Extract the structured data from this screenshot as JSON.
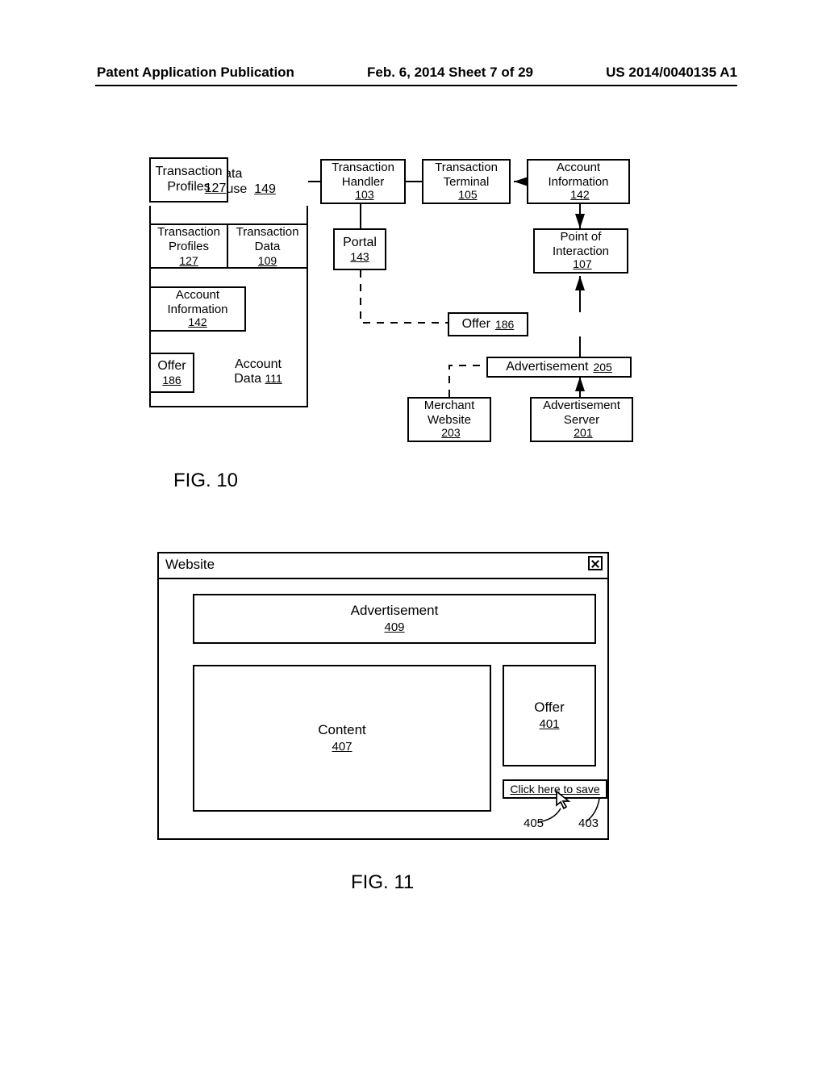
{
  "header": {
    "left": "Patent Application Publication",
    "mid": "Feb. 6, 2014  Sheet 7 of 29",
    "right": "US 2014/0040135 A1"
  },
  "fig10": {
    "data_warehouse": {
      "label": "Data\nWarehouse",
      "num": "149"
    },
    "transaction_profiles": {
      "label": "Transaction\nProfiles",
      "num": "127"
    },
    "transaction_data": {
      "label": "Transaction\nData",
      "num": "109"
    },
    "account_info_left": {
      "label": "Account\nInformation",
      "num": "142"
    },
    "offer_left": {
      "label": "Offer",
      "num": "186"
    },
    "account_data": {
      "label": "Account\nData",
      "num": "111"
    },
    "transaction_handler": {
      "label": "Transaction\nHandler",
      "num": "103"
    },
    "transaction_terminal": {
      "label": "Transaction\nTerminal",
      "num": "105"
    },
    "account_info_right": {
      "label": "Account\nInformation",
      "num": "142"
    },
    "portal": {
      "label": "Portal",
      "num": "143"
    },
    "point_of_interaction": {
      "label": "Point of\nInteraction",
      "num": "107"
    },
    "offer_mid": {
      "label": "Offer",
      "num": "186"
    },
    "advertisement_mid": {
      "label": "Advertisement",
      "num": "205"
    },
    "merchant_website": {
      "label": "Merchant\nWebsite",
      "num": "203"
    },
    "advertisement_server": {
      "label": "Advertisement\nServer",
      "num": "201"
    },
    "caption": "FIG. 10"
  },
  "fig11": {
    "window_title": "Website",
    "advertisement": {
      "label": "Advertisement",
      "num": "409"
    },
    "content": {
      "label": "Content",
      "num": "407"
    },
    "offer": {
      "label": "Offer",
      "num": "401"
    },
    "click_link": "Click here to save",
    "cursor_num": "405",
    "link_num": "403",
    "caption": "FIG. 11"
  }
}
